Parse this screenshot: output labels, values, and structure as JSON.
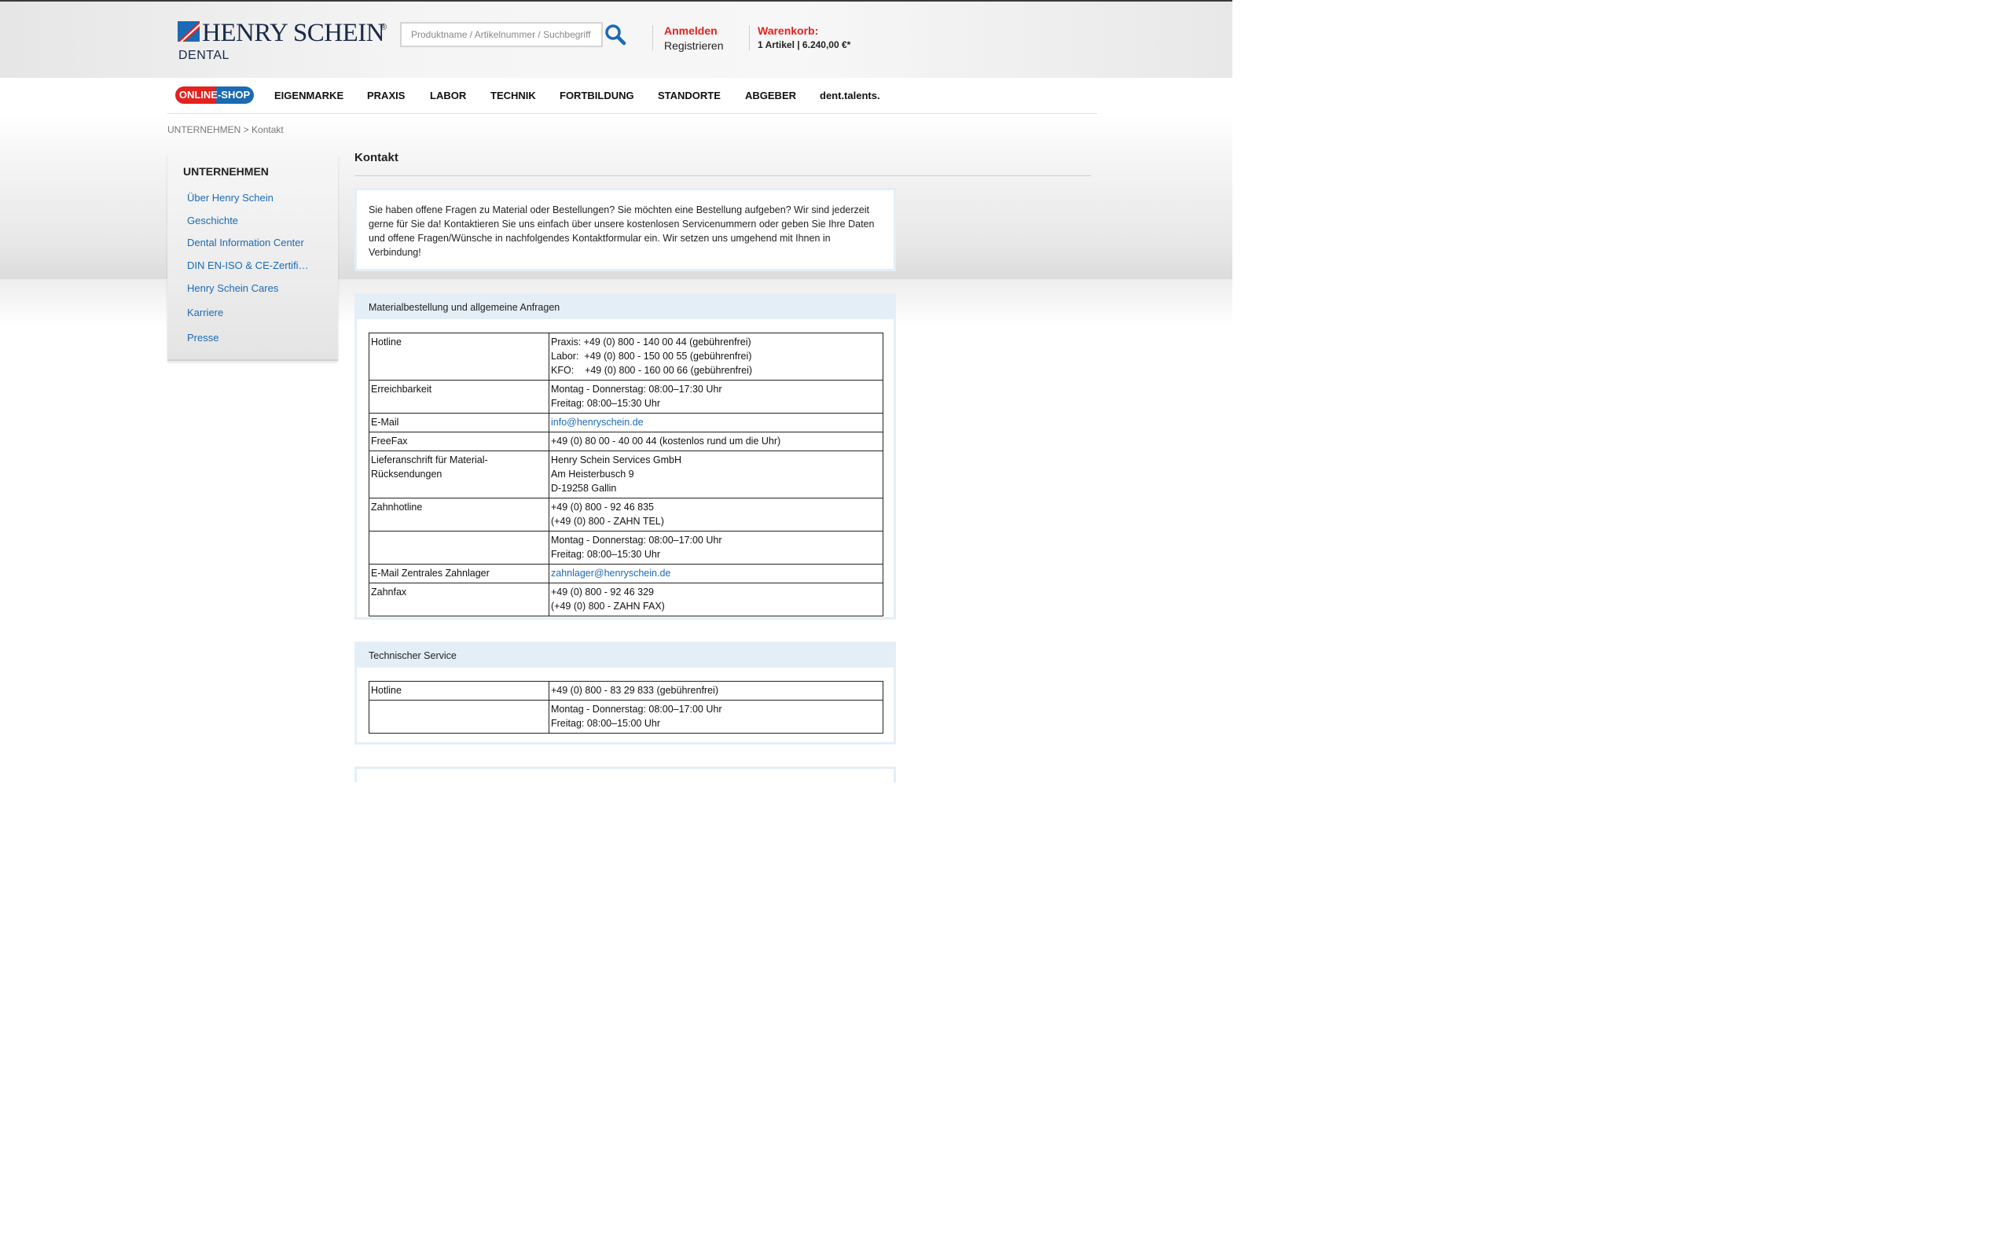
{
  "header": {
    "logo_text": "HENRY SCHEIN",
    "logo_registered": "®",
    "logo_sub": "DENTAL",
    "search_placeholder": "Produktname / Artikelnummer / Suchbegriff",
    "login_label": "Anmelden",
    "register_label": "Registrieren",
    "cart_label": "Warenkorb:",
    "cart_info": "1  Artikel | 6.240,00 €*"
  },
  "nav": {
    "shop_label": "ONLINE-SHOP",
    "items": [
      "EIGENMARKE",
      "PRAXIS",
      "LABOR",
      "TECHNIK",
      "FORTBILDUNG",
      "STANDORTE",
      "ABGEBER",
      "dent.talents."
    ]
  },
  "breadcrumb": "UNTERNEHMEN > Kontakt",
  "sidebar": {
    "title": "UNTERNEHMEN",
    "items": [
      "Über Henry Schein",
      "Geschichte",
      "Dental Information Center",
      "DIN EN-ISO & CE-Zertifi…",
      "Henry Schein Cares",
      "Karriere",
      "Presse"
    ]
  },
  "main": {
    "title": "Kontakt",
    "intro": "Sie haben offene Fragen zu Material oder Bestellungen? Sie möchten eine Bestellung aufgeben? Wir sind jederzeit gerne für Sie da! Kontaktieren Sie uns einfach über unsere kostenlosen Servicenummern oder geben Sie Ihre Daten und offene Fragen/Wünsche in nachfolgendes Kontaktformular ein. Wir setzen uns umgehend mit Ihnen in Verbindung!"
  },
  "panel1": {
    "title": "Materialbestellung und allgemeine Anfragen",
    "rows": [
      {
        "key": "Hotline",
        "value": "Praxis: +49 (0) 800 - 140 00 44 (gebührenfrei)\nLabor:  +49 (0) 800 - 150 00 55 (gebührenfrei)\nKFO:    +49 (0) 800 - 160 00 66 (gebührenfrei)"
      },
      {
        "key": "Erreichbarkeit",
        "value": "Montag - Donnerstag: 08:00–17:30 Uhr\nFreitag: 08:00–15:30 Uhr"
      },
      {
        "key": "E-Mail",
        "value": "info@henryschein.de"
      },
      {
        "key": "FreeFax",
        "value": "+49 (0) 80 00 - 40 00 44 (kostenlos rund um die Uhr)"
      },
      {
        "key": "Lieferanschrift für Material-\nRücksendungen",
        "value": "Henry Schein Services GmbH\nAm Heisterbusch 9\nD-19258 Gallin"
      },
      {
        "key": "Zahnhotline",
        "value": "+49 (0) 800 - 92 46 835\n(+49 (0) 800 - ZAHN TEL)"
      },
      {
        "key": "",
        "value": "Montag - Donnerstag: 08:00–17:00 Uhr\nFreitag: 08:00–15:30 Uhr"
      },
      {
        "key": "E-Mail Zentrales Zahnlager",
        "value": "zahnlager@henryschein.de"
      },
      {
        "key": "Zahnfax",
        "value": "+49 (0) 800 - 92 46 329\n(+49 (0) 800 - ZAHN FAX)"
      }
    ]
  },
  "panel2": {
    "title": "Technischer Service",
    "rows": [
      {
        "key": "Hotline",
        "value": "+49 (0) 800 - 83 29 833 (gebührenfrei)"
      },
      {
        "key": "",
        "value": "Montag - Donnerstag: 08:00–17:00 Uhr\nFreitag: 08:00–15:00 Uhr"
      }
    ]
  },
  "colors": {
    "brand_red": "#e3211f",
    "brand_blue": "#1b6ab4",
    "panel_tint": "#e4eef6"
  }
}
